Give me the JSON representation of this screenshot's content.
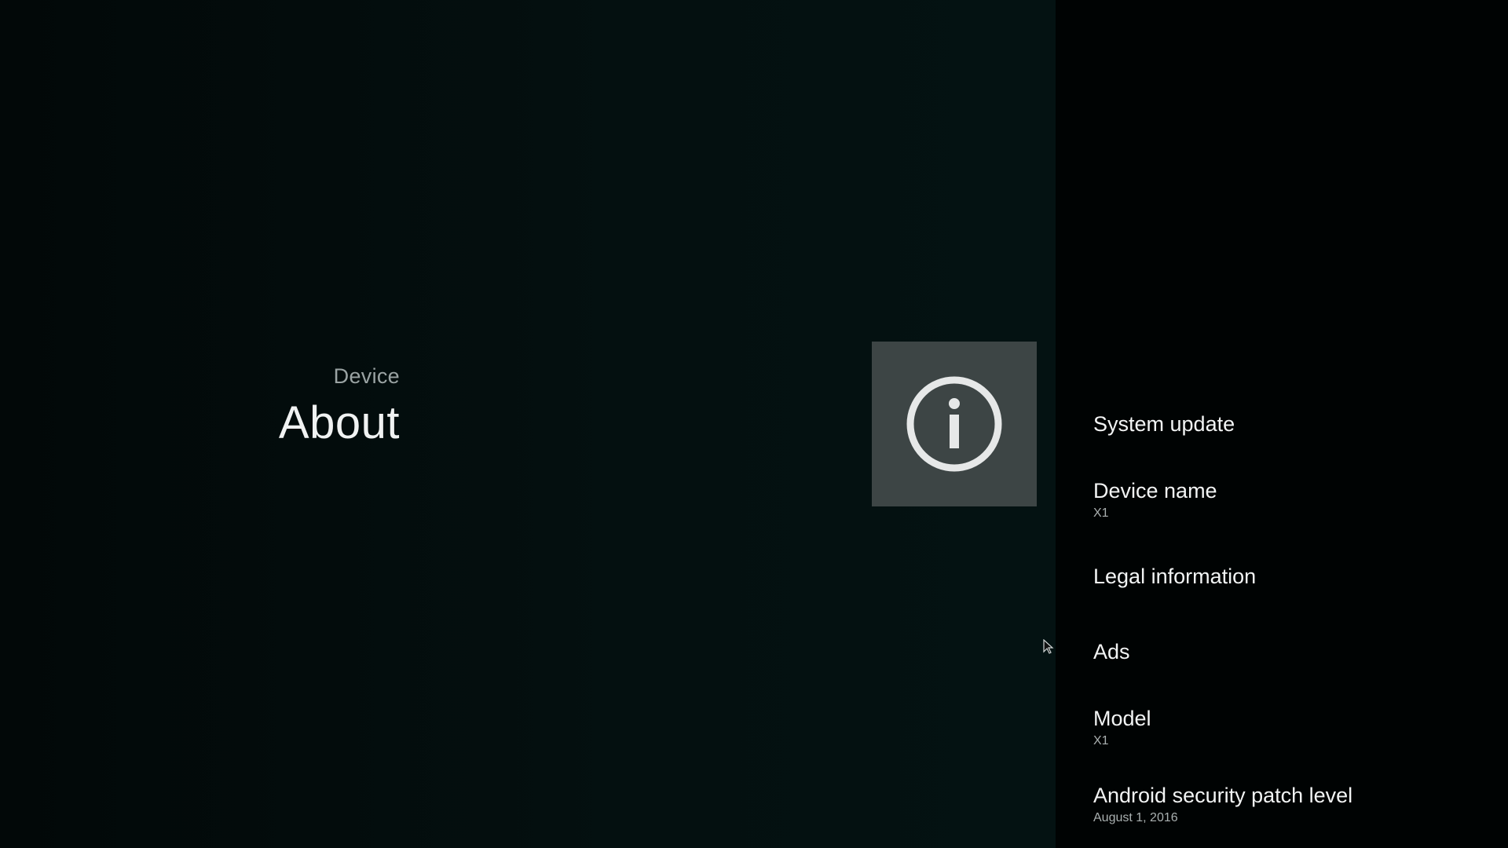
{
  "header": {
    "breadcrumb": "Device",
    "title": "About",
    "icon": "info-icon"
  },
  "menu": {
    "items": [
      {
        "title": "System update",
        "summary": ""
      },
      {
        "title": "Device name",
        "summary": "X1"
      },
      {
        "title": "Legal information",
        "summary": ""
      },
      {
        "title": "Ads",
        "summary": ""
      },
      {
        "title": "Model",
        "summary": "X1"
      },
      {
        "title": "Android security patch level",
        "summary": "August 1, 2016"
      }
    ]
  },
  "colors": {
    "background": "#040c0c",
    "panel": "#000303",
    "icon_tile": "#3d4545",
    "text_primary": "#f0f2f2",
    "text_secondary": "#a9b0b0"
  }
}
